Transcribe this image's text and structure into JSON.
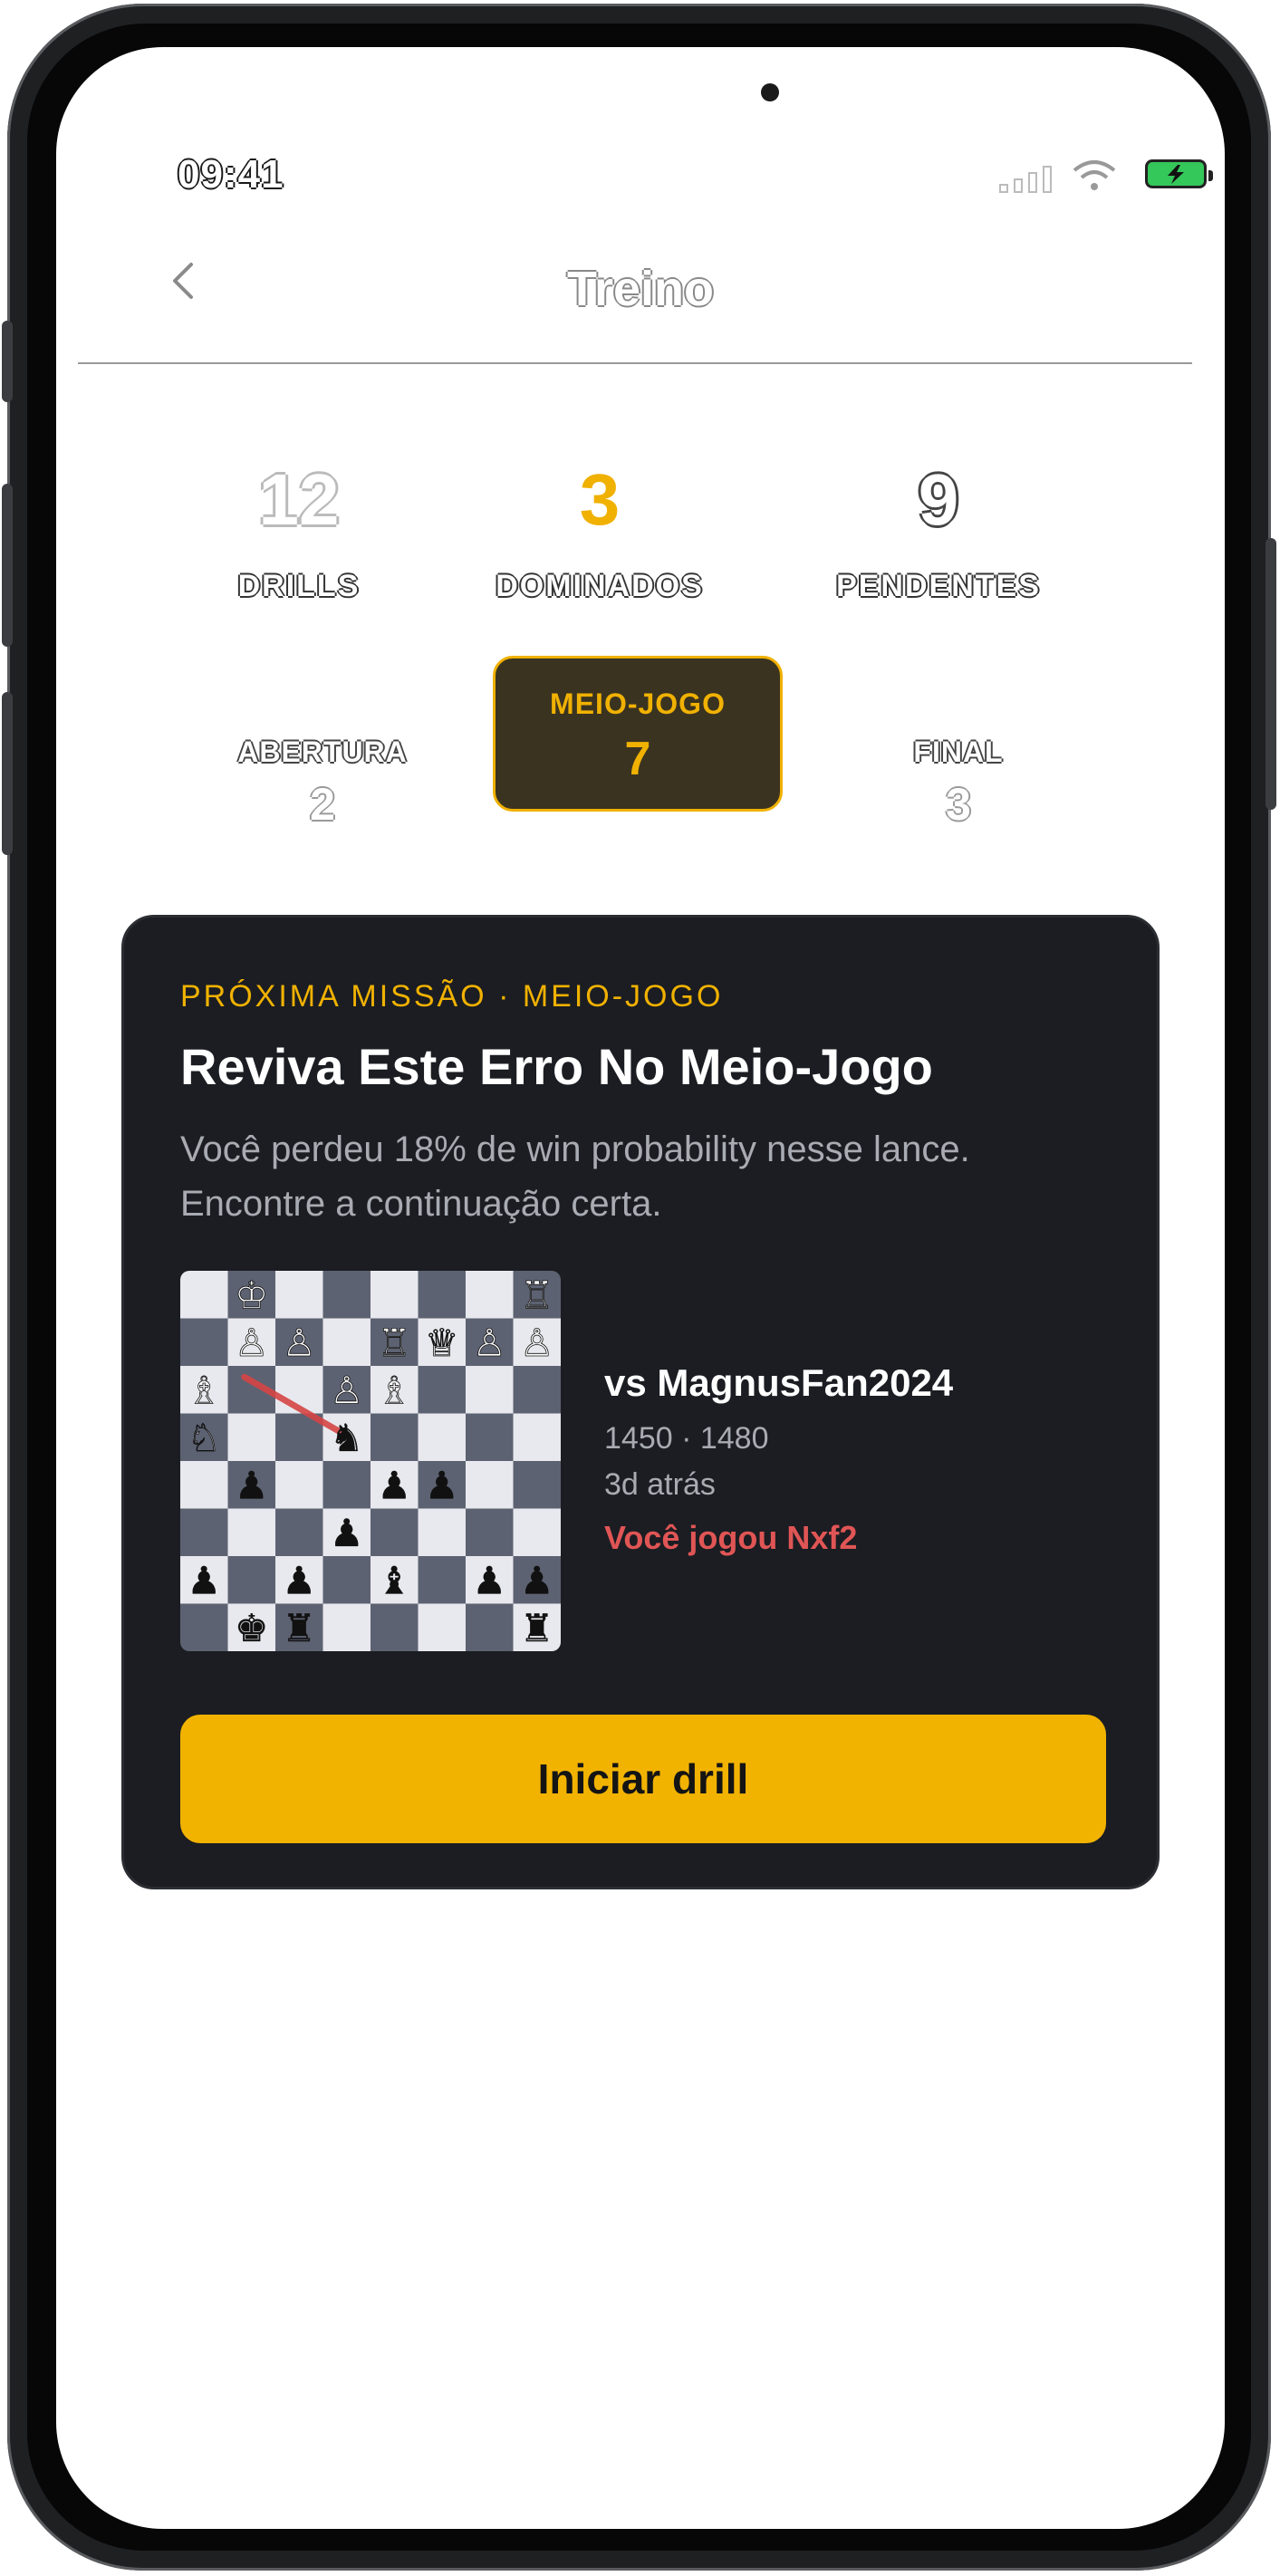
{
  "status_bar": {
    "time": "09:41"
  },
  "nav": {
    "title": "Treino"
  },
  "stats": [
    {
      "value": "12",
      "label": "DRILLS"
    },
    {
      "value": "3",
      "label": "DOMINADOS"
    },
    {
      "value": "9",
      "label": "PENDENTES"
    }
  ],
  "phases": [
    {
      "label": "ABERTURA",
      "count": "2",
      "active": false
    },
    {
      "label": "MEIO-JOGO",
      "count": "7",
      "active": true
    },
    {
      "label": "FINAL",
      "count": "3",
      "active": false
    }
  ],
  "mission": {
    "kicker": "PRÓXIMA MISSÃO · MEIO-JOGO",
    "title": "Reviva Este Erro No Meio-Jogo",
    "description": "Você perdeu 18% de win probability nesse lance. Encontre a continuação certa.",
    "opponent": "vs MagnusFan2024",
    "ratings": "1450 · 1480",
    "time_ago": "3d atrás",
    "played_move": "Você jogou Nxf2",
    "cta_label": "Iniciar drill"
  },
  "board": {
    "rows": [
      [
        "",
        "♔",
        "",
        "",
        "",
        "",
        "",
        "♖"
      ],
      [
        "",
        "♙",
        "♙",
        "",
        "♖",
        "♕",
        "♙",
        "♙"
      ],
      [
        "♗",
        "",
        "",
        "♙",
        "♗",
        "",
        "",
        ""
      ],
      [
        "♘",
        "",
        "",
        "♞",
        "",
        "",
        "",
        ""
      ],
      [
        "",
        "♟",
        "",
        "",
        "♟",
        "♟",
        "",
        ""
      ],
      [
        "",
        "",
        "",
        "♟",
        "",
        "",
        "",
        ""
      ],
      [
        "♟",
        "",
        "♟",
        "",
        "♝",
        "",
        "♟",
        "♟"
      ],
      [
        "",
        "♚",
        "♜",
        "",
        "",
        "",
        "",
        "♜"
      ]
    ],
    "arrow": {
      "from": "2,1",
      "to": "3,3"
    },
    "colors": {
      "light": "#e8e9ee",
      "dark": "#5d6272",
      "arrow": "#d64545"
    }
  },
  "colors": {
    "accent": "#f0b100",
    "card_bg": "#1b1d22",
    "danger": "#e05555"
  }
}
